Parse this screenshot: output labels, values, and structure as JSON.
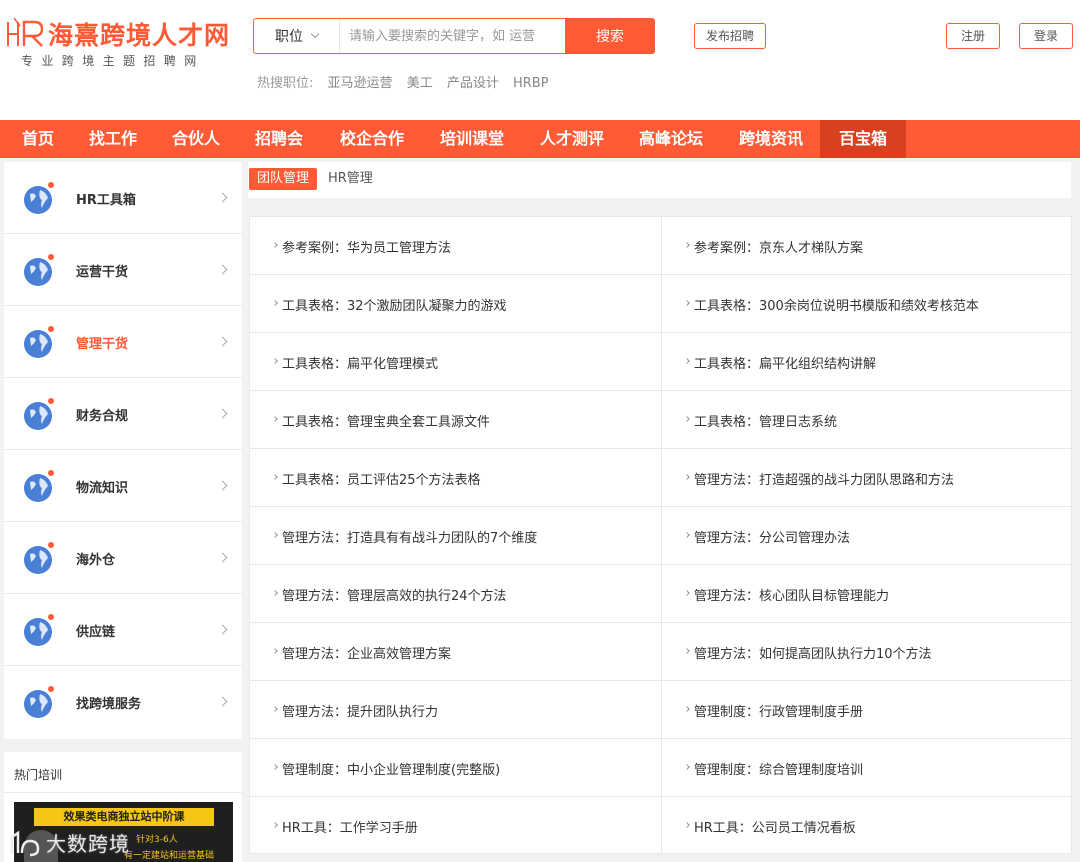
{
  "brand": {
    "name": "海熹跨境人才网",
    "slogan": "专业跨境主题招聘网"
  },
  "search": {
    "type_label": "职位",
    "placeholder": "请输入要搜索的关键字，如 运营",
    "button_label": "搜索"
  },
  "hot_search": {
    "label": "热搜职位:",
    "items": [
      "亚马逊运营",
      "美工",
      "产品设计",
      "HRBP"
    ]
  },
  "header_buttons": {
    "publish": "发布招聘",
    "register": "注册",
    "login": "登录"
  },
  "nav": {
    "items": [
      "首页",
      "找工作",
      "合伙人",
      "招聘会",
      "校企合作",
      "培训课堂",
      "人才测评",
      "高峰论坛",
      "跨境资讯",
      "百宝箱"
    ],
    "active_index": 9
  },
  "sidebar": {
    "items": [
      "HR工具箱",
      "运营干货",
      "管理干货",
      "财务合规",
      "物流知识",
      "海外仓",
      "供应链",
      "找跨境服务"
    ],
    "active_index": 2
  },
  "hot_training": {
    "title": "热门培训",
    "banner_title": "效果类电商独立站中阶课",
    "banner_line1": "针对3-6人",
    "banner_line2": "有一定建站和运营基础"
  },
  "watermark": "大数跨境",
  "tabs": {
    "active": "团队管理",
    "inactive": "HR管理"
  },
  "articles": [
    "参考案例：华为员工管理方法",
    "参考案例：京东人才梯队方案",
    "工具表格：32个激励团队凝聚力的游戏",
    "工具表格：300余岗位说明书模版和绩效考核范本",
    "工具表格：扁平化管理模式",
    "工具表格：扁平化组织结构讲解",
    "工具表格：管理宝典全套工具源文件",
    "工具表格：管理日志系统",
    "工具表格：员工评估25个方法表格",
    "管理方法：打造超强的战斗力团队思路和方法",
    "管理方法：打造具有有战斗力团队的7个维度",
    "管理方法：分公司管理办法",
    "管理方法：管理层高效的执行24个方法",
    "管理方法：核心团队目标管理能力",
    "管理方法：企业高效管理方案",
    "管理方法：如何提高团队执行力10个方法",
    "管理方法：提升团队执行力",
    "管理制度：行政管理制度手册",
    "管理制度：中小企业管理制度(完整版)",
    "管理制度：综合管理制度培训",
    "HR工具：工作学习手册",
    "HR工具：公司员工情况看板"
  ],
  "colors": {
    "accent": "#ff5a36",
    "nav_active": "#d8411f",
    "page_bg": "#f2f2f2"
  }
}
